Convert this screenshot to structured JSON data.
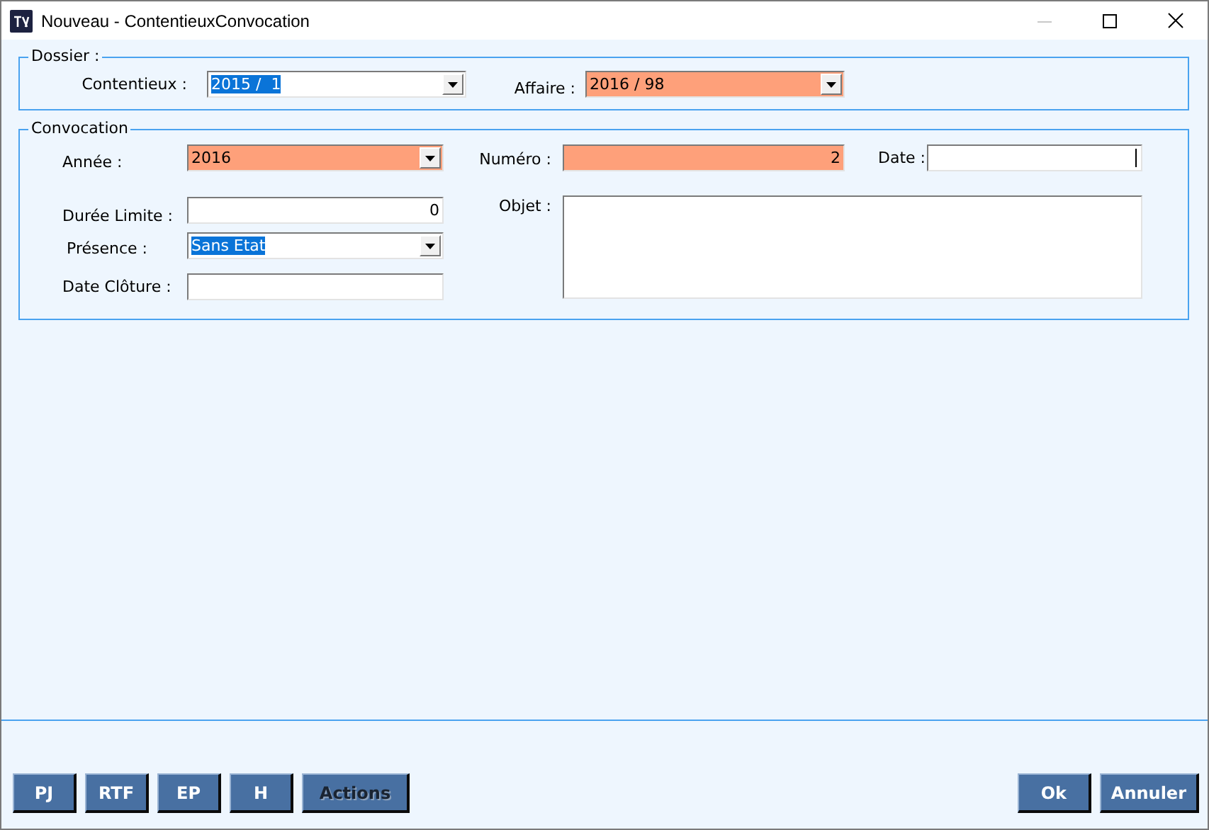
{
  "window": {
    "title": "Nouveau - ContentieuxConvocation",
    "minimize_disabled": true
  },
  "dossier": {
    "legend": "Dossier :",
    "fields": [
      {
        "label": "Contentieux :",
        "kind": "combo",
        "value": "2015 /  1",
        "required": false,
        "text_selected": true
      },
      {
        "label": "Affaire :",
        "kind": "combo",
        "value": "2016 / 98",
        "required": true,
        "text_selected": false
      }
    ]
  },
  "convocation": {
    "legend": "Convocation",
    "fields": [
      {
        "label": "Année :",
        "kind": "combo",
        "value": "2016",
        "required": true,
        "text_selected": false
      },
      {
        "label": "Numéro :",
        "kind": "number",
        "value": "2",
        "required": true,
        "text_selected": false
      },
      {
        "label": "Date :",
        "kind": "text",
        "required": false,
        "focused": true
      },
      {
        "label": "Durée Limite :",
        "kind": "number",
        "value": "0",
        "required": false,
        "text_selected": false
      },
      {
        "label": "Objet :",
        "kind": "memo",
        "required": false
      },
      {
        "label": "Présence :",
        "kind": "combo",
        "value": "Sans Etat",
        "required": false,
        "text_selected": true
      },
      {
        "label": "Date Clôture :",
        "kind": "text",
        "required": false
      }
    ]
  },
  "left_buttons": [
    {
      "label": "PJ",
      "disabled": false
    },
    {
      "label": "RTF",
      "disabled": false
    },
    {
      "label": "EP",
      "disabled": false
    },
    {
      "label": "H",
      "disabled": false
    },
    {
      "label": "Actions",
      "disabled": true
    }
  ],
  "right_buttons": [
    {
      "label": "Ok",
      "disabled": false
    },
    {
      "label": "Annuler",
      "disabled": false
    }
  ]
}
